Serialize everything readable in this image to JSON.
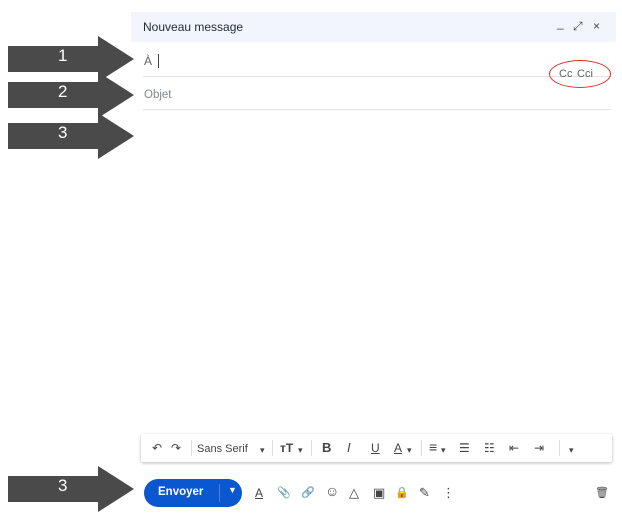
{
  "compose": {
    "title": "Nouveau message",
    "to_label": "À",
    "subject_placeholder": "Objet",
    "cc_label": "Cc",
    "cci_label": "Cci",
    "controls": {
      "minimize": "_",
      "popout": "⤢",
      "close": "×"
    }
  },
  "format_toolbar": {
    "undo": "↶",
    "redo": "↷",
    "font_family": "Sans Serif",
    "font_dropdown": "▾",
    "text_size": "тT",
    "text_size_dropdown": "▾",
    "bold": "B",
    "italic": "I",
    "underline": "U",
    "text_color": "A",
    "text_color_dropdown": "▾",
    "align": "≡",
    "align_dropdown": "▾",
    "numbered_list": "☰",
    "bulleted_list": "☷",
    "indent_less": "⇤",
    "indent_more": "⇥",
    "more": "▾"
  },
  "action_bar": {
    "send_label": "Envoyer",
    "send_more": "▼",
    "formatting": "A",
    "attach": "📎",
    "link": "🔗",
    "emoji": "☺",
    "drive": "△",
    "photo": "▣",
    "confidential": "🔒",
    "signature": "✎",
    "more": "⋮",
    "trash": "🗑"
  },
  "annotations": [
    {
      "number": "1"
    },
    {
      "number": "2"
    },
    {
      "number": "3"
    },
    {
      "number": "3"
    }
  ],
  "colors": {
    "title_bar": "#f2f6fc",
    "send_button": "#0b57d0",
    "arrow": "#4a4a4a",
    "highlight_oval": "#d93025"
  }
}
